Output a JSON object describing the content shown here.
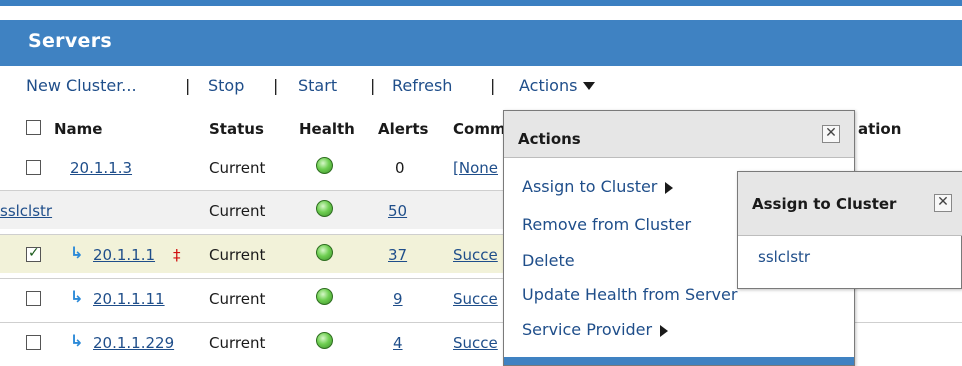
{
  "panel": {
    "title": "Servers"
  },
  "toolbar": {
    "new_cluster": "New Cluster...",
    "stop": "Stop",
    "start": "Start",
    "refresh": "Refresh",
    "actions": "Actions",
    "separator": "|"
  },
  "table": {
    "columns": [
      "Name",
      "Status",
      "Health",
      "Alerts",
      "Comm",
      "ation"
    ],
    "rows": [
      {
        "name": "20.1.1.3",
        "status": "Current",
        "alerts": "0",
        "comm": "[None"
      },
      {
        "name": "sslclstr",
        "status": "Current",
        "alerts": "50",
        "comm": ""
      },
      {
        "name": "20.1.1.1",
        "marker": "‡",
        "status": "Current",
        "alerts": "37",
        "comm": "Succe",
        "checked": true
      },
      {
        "name": "20.1.1.11",
        "status": "Current",
        "alerts": "9",
        "comm": "Succe"
      },
      {
        "name": "20.1.1.229",
        "status": "Current",
        "alerts": "4",
        "comm": "Succe"
      }
    ],
    "health_status": "green"
  },
  "actions_menu": {
    "title": "Actions",
    "close": "✕",
    "items": [
      "Assign to Cluster",
      "Remove from Cluster",
      "Delete",
      "Update Health from Server",
      "Service Provider"
    ]
  },
  "assign_menu": {
    "title": "Assign to Cluster",
    "close": "✕",
    "items": [
      "sslclstr"
    ]
  },
  "colors": {
    "header_blue": "#3f82c2",
    "link_blue": "#1f4e8a",
    "health_green": "#6fcf52",
    "selected_row": "#f2f2d9"
  }
}
